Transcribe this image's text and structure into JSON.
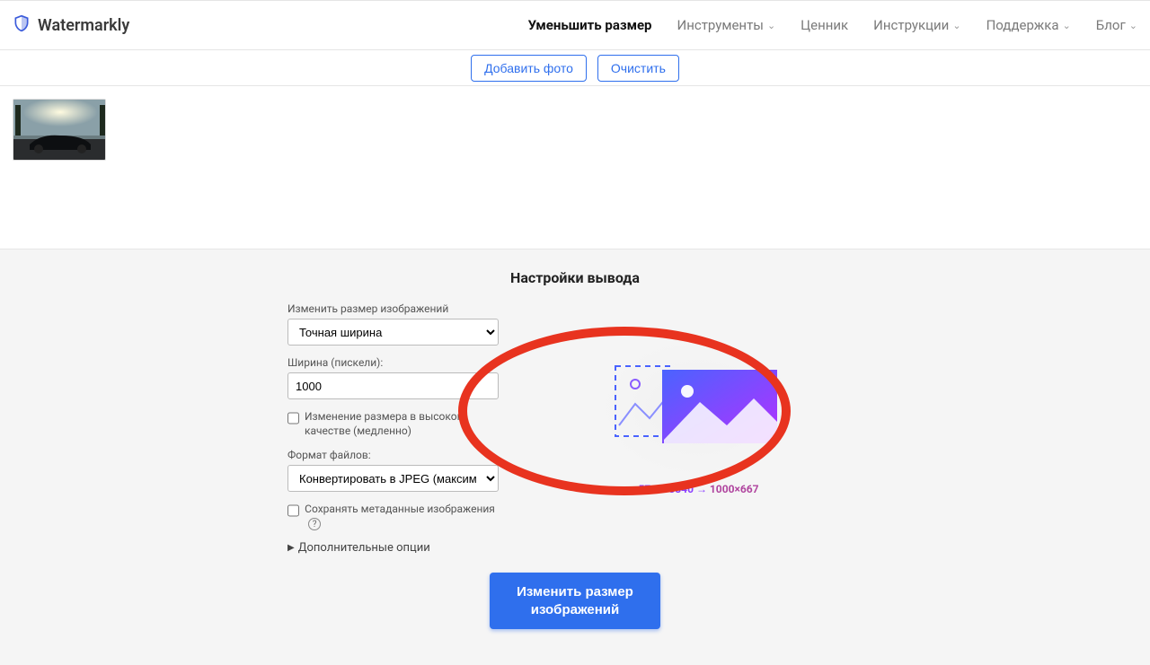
{
  "brand": {
    "name": "Watermarkly"
  },
  "nav": {
    "resize": "Уменьшить размер",
    "tools": "Инструменты",
    "pricing": "Ценник",
    "docs": "Инструкции",
    "support": "Поддержка",
    "blog": "Блог"
  },
  "actions": {
    "add_photo": "Добавить фото",
    "clear": "Очистить"
  },
  "settings": {
    "title": "Настройки вывода",
    "resize_label": "Изменить размер изображений",
    "resize_mode": "Точная ширина",
    "width_label": "Ширина (пискели):",
    "width_value": "1000",
    "hq_label": "Изменение размера в высоком качестве (медленно)",
    "format_label": "Формат файлов:",
    "format_value": "Конвертировать в JPEG (максимал",
    "keep_meta": "Сохранять метаданные изображения",
    "more_options": "Дополнительные опции",
    "submit_line1": "Изменить размер",
    "submit_line2": "изображений"
  },
  "preview": {
    "src_dims": "5760×3840",
    "arrow": "→",
    "dst_dims": "1000×667"
  }
}
